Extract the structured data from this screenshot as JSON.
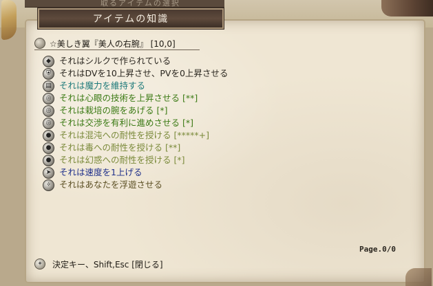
{
  "window": {
    "title": "アイテムの知識"
  },
  "background": {
    "partial_title": "取るアイテムの選択"
  },
  "item": {
    "name": "☆美しき翼『美人の右腕』 [10,0]"
  },
  "properties": [
    {
      "text": "それはシルクで作られている",
      "color": "#2a261f",
      "icon": "silk-icon"
    },
    {
      "text": "それはDVを10上昇させ、PVを0上昇させる",
      "color": "#2a261f",
      "icon": "armor-icon"
    },
    {
      "text": "それは魔力を維持する",
      "color": "#1f7a7a",
      "icon": "cloth-icon"
    },
    {
      "text": "それは心眼の技術を上昇させる [**]",
      "color": "#3b7a14",
      "icon": "skill-icon"
    },
    {
      "text": "それは栽培の腕をあげる [*]",
      "color": "#3b7a14",
      "icon": "skill-icon"
    },
    {
      "text": "それは交渉を有利に進めさせる [*]",
      "color": "#3b7a14",
      "icon": "skill-icon"
    },
    {
      "text": "それは混沌への耐性を授ける [*****+]",
      "color": "#7a8a3a",
      "icon": "resist-icon"
    },
    {
      "text": "それは毒への耐性を授ける [**]",
      "color": "#7a8a3a",
      "icon": "resist-icon"
    },
    {
      "text": "それは幻惑への耐性を授ける [*]",
      "color": "#7a8a3a",
      "icon": "resist-icon"
    },
    {
      "text": "それは速度を1上げる",
      "color": "#1e2f8a",
      "icon": "speed-icon"
    },
    {
      "text": "それはあなたを浮遊させる",
      "color": "#5c5024",
      "icon": "float-icon"
    }
  ],
  "page_indicator": "Page.0/0",
  "footer": {
    "hint": "決定キー、Shift,Esc [閉じる]"
  }
}
